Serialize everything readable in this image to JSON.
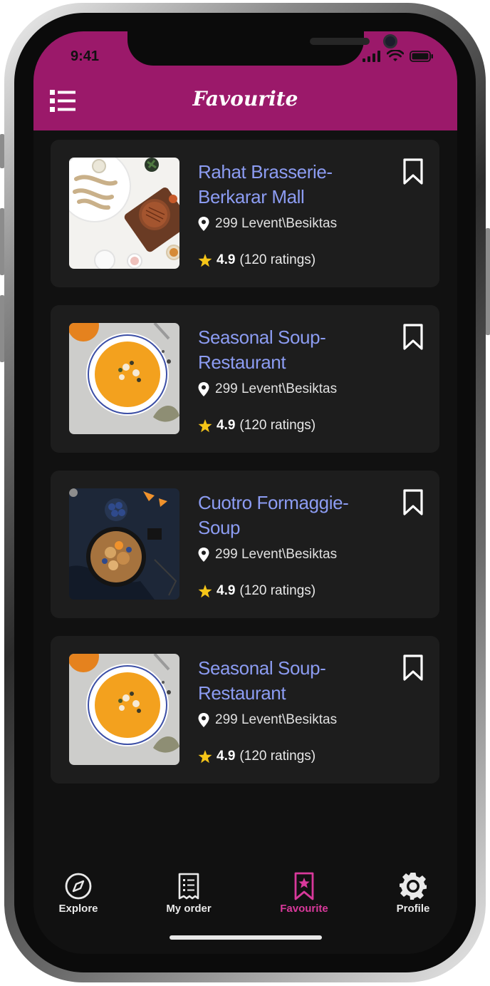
{
  "status_bar": {
    "time": "9:41"
  },
  "header": {
    "title": "Favourite",
    "menu_icon": "list-icon"
  },
  "colors": {
    "header": "#9b196a",
    "accent": "#d9399b",
    "name": "#8c9cf2",
    "star": "#f5c518",
    "card": "#1d1d1d",
    "background": "#111111"
  },
  "favourites": [
    {
      "name": "Rahat Brasserie-Berkarar Mall",
      "address": "299 Levent\\Besiktas",
      "score": "4.9",
      "ratings": "(120 ratings)",
      "image": "steak-burger-dish"
    },
    {
      "name": "Seasonal Soup-Restaurant",
      "address": "299 Levent\\Besiktas",
      "score": "4.9",
      "ratings": "(120 ratings)",
      "image": "pumpkin-soup-bowl"
    },
    {
      "name": "Cuotro Formaggie-Soup",
      "address": "299 Levent\\Besiktas",
      "score": "4.9",
      "ratings": "(120 ratings)",
      "image": "oatmeal-blueberry-pan"
    },
    {
      "name": "Seasonal Soup-Restaurant",
      "address": "299 Levent\\Besiktas",
      "score": "4.9",
      "ratings": "(120 ratings)",
      "image": "pumpkin-soup-bowl"
    }
  ],
  "tabs": [
    {
      "label": "Explore",
      "icon": "compass-icon",
      "active": false
    },
    {
      "label": "My order",
      "icon": "receipt-icon",
      "active": false
    },
    {
      "label": "Favourite",
      "icon": "bookmark-star-icon",
      "active": true
    },
    {
      "label": "Profile",
      "icon": "gear-icon",
      "active": false
    }
  ]
}
